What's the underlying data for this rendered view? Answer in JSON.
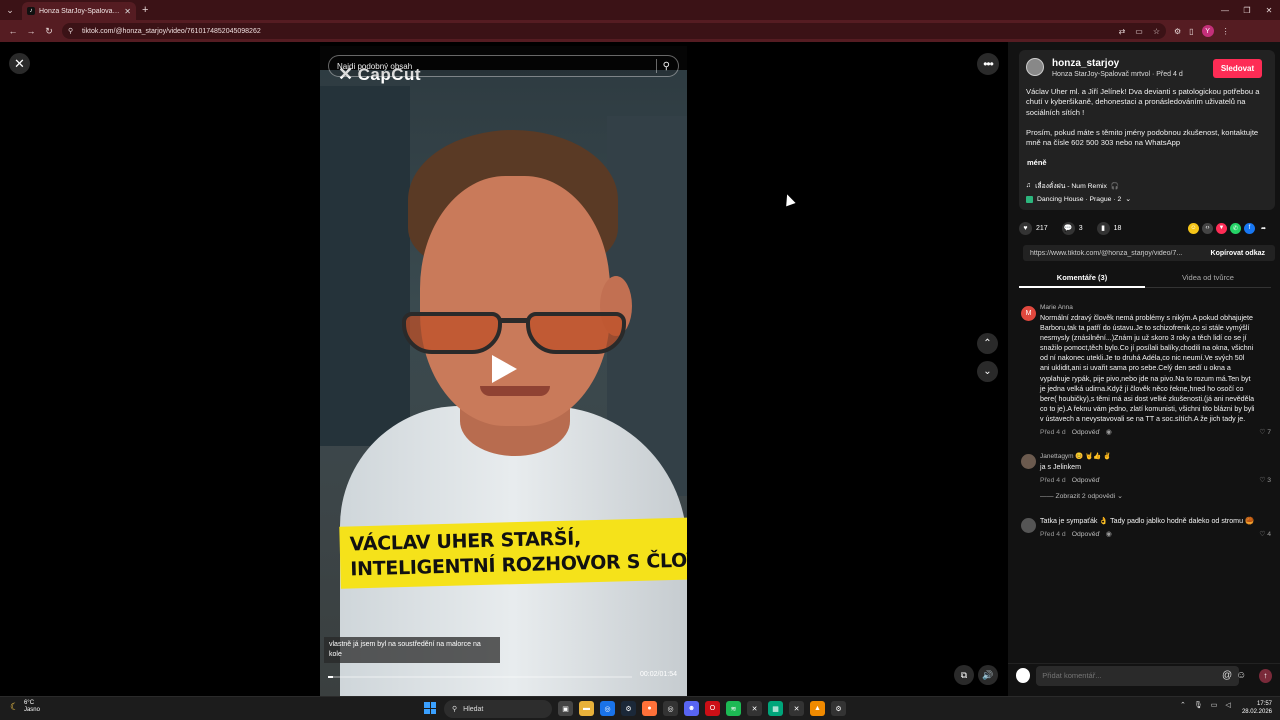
{
  "browser": {
    "tab_title": "Honza StarJoy-Spalovač mrtvol",
    "url": "tiktok.com/@honza_starjoy/video/7610174852045098262",
    "profile_initial": "Y"
  },
  "video": {
    "search_placeholder": "Najdi podobný obsah",
    "watermark": "CapCut",
    "caption_line1": "VÁCLAV UHER STARŠÍ,",
    "caption_line2": "INTELIGENTNÍ ROZHOVOR S ČLOVĚKEM,",
    "subtitle": "vlastně já jsem byl na soustředění na malorce na kole",
    "timecode": "00:02/01:54",
    "progress": 0.017
  },
  "author": {
    "username": "honza_starjoy",
    "subline": "Honza StarJoy-Spalovač mrtvol · Před 4 d",
    "follow_label": "Sledovat"
  },
  "description": {
    "p1": "Václav Uher ml. a Jiří Jelínek! Dva devianti s patologickou potřebou a chutí v kyberšikaně, dehonestaci a pronásledováním uživatelů na sociálních sítích !",
    "p2": "Prosím, pokud máte s těmito jmény podobnou zkušenost, kontaktujte mně na čísle 602 500 303 nebo na WhatsApp",
    "less": "méně",
    "music": "เลื่องดั่งฝน - Num Remix",
    "location": "Dancing House · Prague · 2"
  },
  "stats": {
    "likes": "217",
    "comments": "3",
    "saves": "18"
  },
  "share_colors": [
    "#f5c518",
    "#444444",
    "#fe2c55",
    "#25d366",
    "#1877f2"
  ],
  "link": {
    "url": "https://www.tiktok.com/@honza_starjoy/video/7...",
    "copy_label": "Kopírovat odkaz"
  },
  "tabs": {
    "comments": "Komentáře (3)",
    "creator_videos": "Videa od tvůrce"
  },
  "comments": [
    {
      "user": "Marie Anna",
      "avatar": "M",
      "text": "Normální zdravý člověk nemá problémy s nikým.A pokud obhajujete Barboru,tak ta patří do ústavu.Je to schizofrenik,co si stále vymýšlí nesmysly (znásilnění...)Znám ju už skoro 3 roky a těch lidí co se jí snažilo pomoct,těch bylo.Co jí posílali balíky,chodili na okna, všichni od ní nakonec utekli.Je to druhá Adéla,co nic neumí.Ve svých 50l ani uklidit,ani si uvařit sama pro sebe.Celý den sedí u okna a vyplahuje rypák, pije pivo,nebo jde na pivo.Na to rozum má.Ten byt je jedna velká udirna.Když jí člověk něco řekne,hned ho osočí co bere( houbičky),s těmi má asi dost velké zkušenosti.(já ani nevěděla co to je).A řeknu vám jedno, zlatí komunisti, všichni tito blázni by byli v ústavech a nevystavovali se na TT a soc.sítích.A že jich tady je.",
      "time": "Před 4 d",
      "reply": "Odpověď",
      "likes": "7"
    },
    {
      "user": "Janettagym 😊 🤘👍 ✌",
      "avatar": "",
      "text": "ja s Jelinkem",
      "time": "Před 4 d",
      "reply": "Odpověď",
      "likes": "3"
    },
    {
      "user": "",
      "avatar": "",
      "text": "Tatka je sympaťák 👌 Tady padlo jablko hodně daleko od stromu 🥮",
      "time": "Před 4 d",
      "reply": "Odpověď",
      "likes": "4"
    }
  ],
  "more_replies": "Zobrazit 2 odpovědi",
  "comment_input": {
    "placeholder": "Přidat komentář..."
  },
  "taskbar": {
    "temp": "6°C",
    "weather_text": "Jasno",
    "search": "Hledat",
    "time": "17:57",
    "date": "28.02.2026"
  }
}
